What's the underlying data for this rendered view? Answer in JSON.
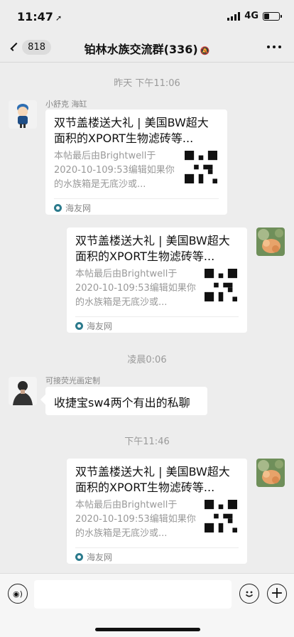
{
  "status_bar": {
    "time": "11:47",
    "network": "4G"
  },
  "header": {
    "back_count": "818",
    "title": "铂林水族交流群(336)"
  },
  "messages": {
    "ts1": "昨天 下午11:06",
    "m1_sender": "小舒克 海缸",
    "link1": {
      "title": "双节盖楼送大礼 | 美国BW超大面积的XPORT生物滤砖等...",
      "desc": "本帖最后由Brightwell于2020-10-109:53编辑如果你的水族箱是无底沙或...",
      "source": "海友网"
    },
    "link2": {
      "title": "双节盖楼送大礼 | 美国BW超大面积的XPORT生物滤砖等...",
      "desc": "本帖最后由Brightwell于2020-10-109:53编辑如果你的水族箱是无底沙或...",
      "source": "海友网"
    },
    "ts2": "凌晨0:06",
    "m3_sender": "可接荧光画定制",
    "m3_text": "收捷宝sw4两个有出的私聊",
    "ts3": "下午11:46",
    "link3": {
      "title": "双节盖楼送大礼 | 美国BW超大面积的XPORT生物滤砖等...",
      "desc": "本帖最后由Brightwell于2020-10-109:53编辑如果你的水族箱是无底沙或...",
      "source": "海友网"
    }
  },
  "colors": {
    "background": "#ededed",
    "bubble": "#ffffff",
    "timestamp": "#9a9a9a",
    "source_icon": "#2b7a8c"
  }
}
